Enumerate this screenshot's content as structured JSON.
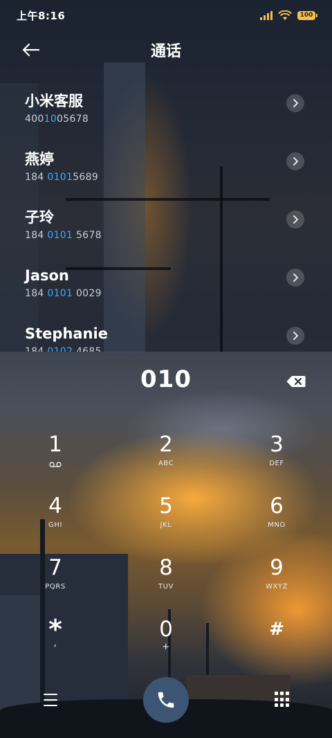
{
  "status_bar": {
    "time": "上午8:16",
    "battery": "100",
    "icons": [
      "signal-icon",
      "wifi-icon",
      "battery-icon"
    ]
  },
  "header": {
    "title": "通话",
    "back_icon": "back-arrow-icon"
  },
  "contacts": [
    {
      "name": "小米客服",
      "number_pre": "400",
      "number_match": "1005678",
      "number_post": ""
    },
    {
      "name": "燕婷",
      "number_pre": "184 ",
      "number_match": "0101",
      "number_post": "5689"
    },
    {
      "name": "子玲",
      "number_pre": "184 ",
      "number_match": "0101",
      "number_post": " 5678"
    },
    {
      "name": "Jason",
      "number_pre": "184 ",
      "number_match": "0101",
      "number_post": " 0029"
    },
    {
      "name": "Stephanie",
      "number_pre": "184 ",
      "number_match": "0102",
      "number_post": " 4685"
    }
  ],
  "dialer": {
    "entered_number": "010",
    "keys": [
      {
        "digit": "1",
        "letters": "",
        "sub_icon": "voicemail-icon"
      },
      {
        "digit": "2",
        "letters": "ABC"
      },
      {
        "digit": "3",
        "letters": "DEF"
      },
      {
        "digit": "4",
        "letters": "GHI"
      },
      {
        "digit": "5",
        "letters": "JKL"
      },
      {
        "digit": "6",
        "letters": "MNO"
      },
      {
        "digit": "7",
        "letters": "PQRS"
      },
      {
        "digit": "8",
        "letters": "TUV"
      },
      {
        "digit": "9",
        "letters": "WXYZ"
      },
      {
        "digit": "*",
        "letters": ","
      },
      {
        "digit": "0",
        "letters": "+"
      },
      {
        "digit": "#",
        "letters": ""
      }
    ]
  },
  "bottom_bar": {
    "icons": [
      "menu-icon",
      "phone-icon",
      "keypad-icon"
    ]
  },
  "colors": {
    "highlight": "#3fa9ff",
    "call_button": "#3c5573",
    "status_accent": "#f5c04a"
  }
}
